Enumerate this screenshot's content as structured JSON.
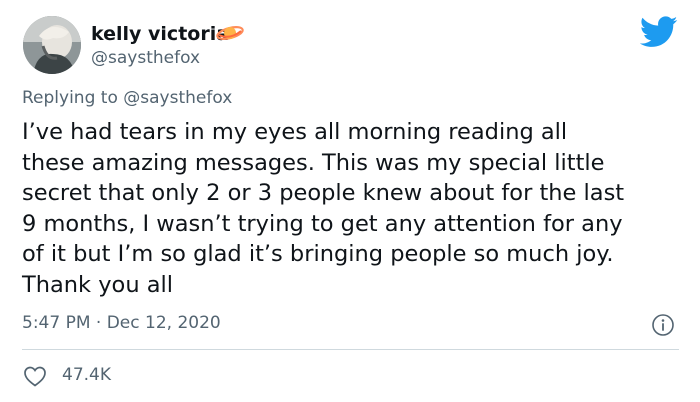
{
  "author": {
    "name": "kelly victoria",
    "handle": "@saysthefox",
    "emoji_icon": "pink-orange-planet-emoji"
  },
  "platform_icon": "twitter-bird-icon",
  "reply": {
    "prefix": "Replying to",
    "mention": "@saysthefox"
  },
  "tweet": {
    "lines": [
      "I’ve had tears in my eyes all morning reading all",
      "these amazing messages. This was my special little",
      "secret that only 2 or 3 people knew about for the last",
      "9 months, I wasn’t trying to get any attention for any",
      "of it but I’m so glad it’s bringing people so much joy.",
      "Thank you all"
    ]
  },
  "meta": {
    "timestamp": "5:47 PM · Dec 12, 2020"
  },
  "actions": {
    "like_icon": "heart-icon",
    "like_count": "47.4K",
    "info_icon": "info-icon"
  },
  "colors": {
    "text": "#0f1419",
    "secondary": "#536471",
    "brand": "#1d9bf0",
    "divider": "#cfd9de"
  }
}
